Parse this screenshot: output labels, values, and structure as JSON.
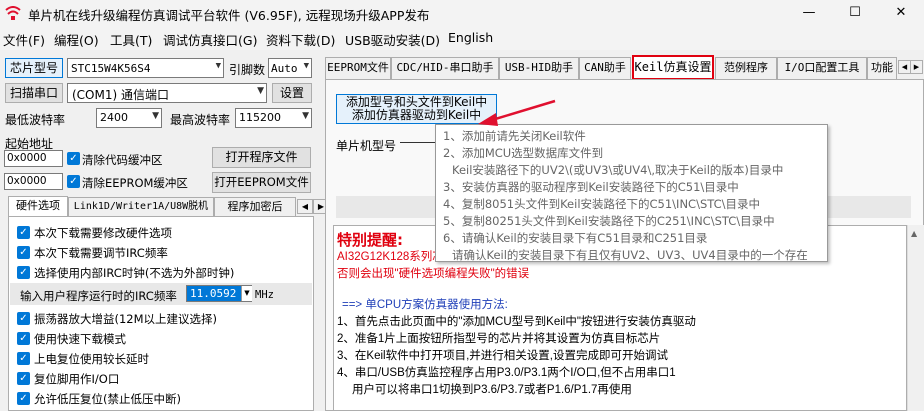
{
  "window": {
    "title": "单片机在线升级编程仿真调试平台软件 (V6.95F), 远程现场升级APP发布",
    "controls": {
      "minimize": "—",
      "maximize": "☐",
      "close": "✕"
    }
  },
  "menu": [
    "文件(F)",
    "编程(O)",
    "工具(T)",
    "调试仿真接口(G)",
    "资料下载(D)",
    "USB驱动安装(D)",
    "English"
  ],
  "left": {
    "chip_model_button": "芯片型号",
    "chip_model_value": "STC15W4K56S4",
    "pins_label": "引脚数",
    "pins_value": "Auto",
    "scan_port_button": "扫描串口",
    "port_value": "(COM1) 通信端口",
    "settings_button": "设置",
    "min_baud_label": "最低波特率",
    "min_baud_value": "2400",
    "max_baud_label": "最高波特率",
    "max_baud_value": "115200",
    "start_addr_label": "起始地址",
    "code_addr": "0x0000",
    "clear_code_label": "清除代码缓冲区",
    "open_program_button": "打开程序文件",
    "eeprom_addr": "0x0000",
    "clear_eeprom_label": "清除EEPROM缓冲区",
    "open_eeprom_button": "打开EEPROM文件",
    "tabs": [
      "硬件选项",
      "Link1D/Writer1A/U8W脱机",
      "程序加密后"
    ],
    "options": [
      "本次下载需要修改硬件选项",
      "本次下载需要调节IRC频率",
      "选择使用内部IRC时钟(不选为外部时钟)",
      "振荡器放大增益(12M以上建议选择)",
      "使用快速下载模式",
      "上电复位使用较长延时",
      "复位脚用作I/O口",
      "允许低压复位(禁止低压中断)"
    ],
    "irc_label": "输入用户程序运行时的IRC频率",
    "irc_value": "11.0592",
    "irc_unit": "MHz"
  },
  "right": {
    "tabs": [
      "EEPROM文件",
      "CDC/HID-串口助手",
      "USB-HID助手",
      "CAN助手",
      "Keil仿真设置",
      "范例程序",
      "I/O口配置工具",
      "功能"
    ],
    "selected_tab": "Keil仿真设置",
    "add_keil_button_line1": "添加型号和头文件到Keil中",
    "add_keil_button_line2": "添加仿真器驱动到Keil中",
    "mcu_model_label": "单片机型号",
    "tooltip_lines": [
      "1、添加前请先关闭Keil软件",
      "2、添加MCU选型数据库文件到",
      "Keil安装路径下的UV2\\(或UV3\\或UV4\\,取决于Keil的版本)目录中",
      "3、安装仿真器的驱动程序到Keil安装路径下的C51\\目录中",
      "4、复制8051头文件到Keil安装路径下的C51\\INC\\STC\\目录中",
      "5、复制80251头文件到Keil安装路径下的C251\\INC\\STC\\目录中",
      "6、请确认Keil的安装目录下有C51目录和C251目录",
      "请确认Keil的安装目录下有且仅有UV2、UV3、UV4目录中的一个存在"
    ],
    "warning_title": "特别提醒:",
    "warning_line1": "AI32G12K128系列芯",
    "warning_line2": "否则会出现\"硬件选项编程失败\"的错误",
    "method_title": "==> 单CPU方案仿真器使用方法:",
    "steps": [
      "1、首先点击此页面中的\"添加MCU型号到Keil中\"按钮进行安装仿真驱动",
      "2、准备1片上面按钮所指型号的芯片并将其设置为仿真目标芯片",
      "3、在Keil软件中打开项目,并进行相关设置,设置完成即可开始调试",
      "4、串口/USB仿真监控程序占用P3.0/P3.1两个I/O口,但不占用串口1",
      "用户可以将串口1切换到P3.6/P3.7或者P1.6/P1.7再使用"
    ]
  },
  "colors": {
    "accent": "#0078d7",
    "warning": "#e0000f",
    "link": "#1f3fb8",
    "tab_highlight": "#e0000f"
  }
}
